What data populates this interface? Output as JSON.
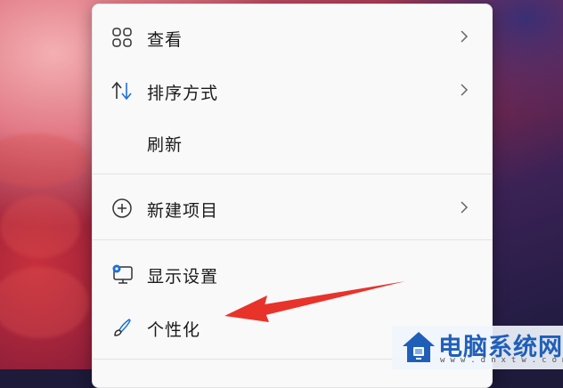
{
  "context_menu": {
    "items": [
      {
        "label": "查看",
        "icon": "view-grid-icon",
        "has_submenu": true
      },
      {
        "label": "排序方式",
        "icon": "sort-arrows-icon",
        "has_submenu": true
      },
      {
        "label": "刷新",
        "icon": "",
        "has_submenu": false
      },
      {
        "label": "新建项目",
        "icon": "plus-circle-icon",
        "has_submenu": true
      },
      {
        "label": "显示设置",
        "icon": "display-settings-icon",
        "has_submenu": false
      },
      {
        "label": "个性化",
        "icon": "brush-icon",
        "has_submenu": false
      }
    ]
  },
  "annotation": {
    "type": "red-arrow",
    "target": "个性化",
    "color": "#e8332b"
  },
  "watermark": {
    "title": "电脑系统网",
    "url": "www.dnxtw.com"
  },
  "colors": {
    "menu_bg": "#f9f9f9",
    "accent_blue": "#1f6fd1",
    "arrow_red": "#e8332b"
  }
}
